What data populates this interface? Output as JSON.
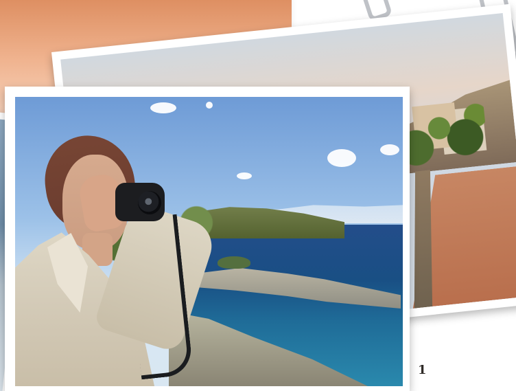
{
  "page_indicator": "1"
}
